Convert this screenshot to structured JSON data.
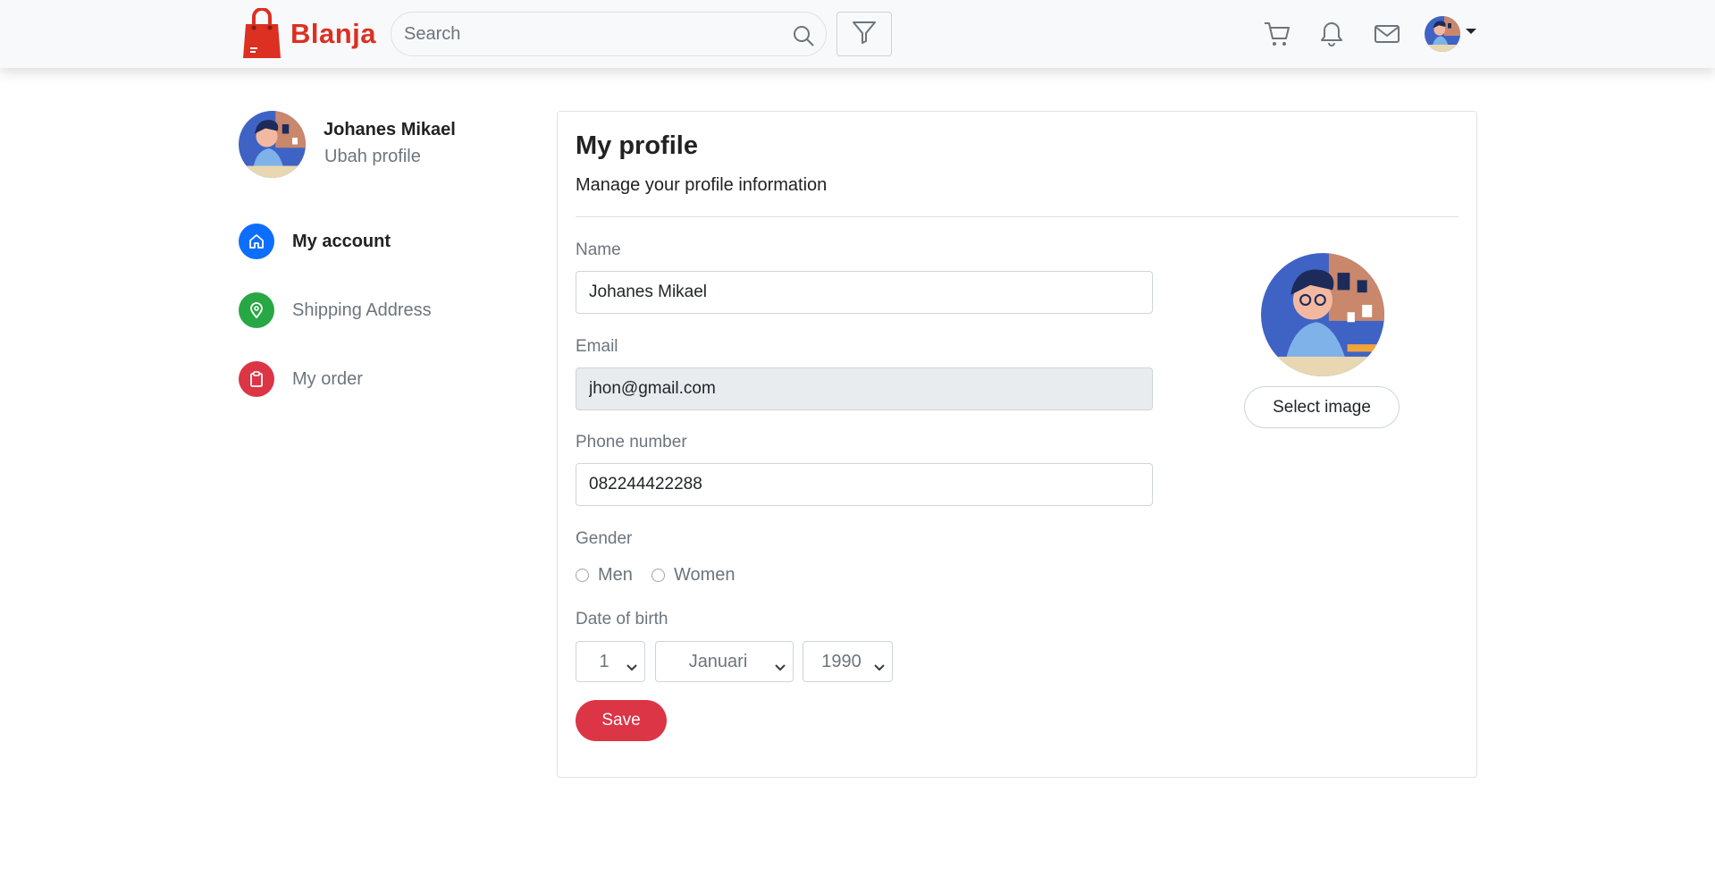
{
  "brand": {
    "name": "Blanja",
    "color": "#db3022"
  },
  "search": {
    "placeholder": "Search"
  },
  "nav": {
    "icons": [
      "filter-icon",
      "cart-icon",
      "bell-icon",
      "mail-icon"
    ]
  },
  "sidebar": {
    "user_name": "Johanes Mikael",
    "edit_label": "Ubah profile",
    "items": [
      {
        "label": "My account",
        "icon": "home-icon",
        "color": "#0d6efd",
        "active": true
      },
      {
        "label": "Shipping Address",
        "icon": "map-pin-icon",
        "color": "#28a745",
        "active": false
      },
      {
        "label": "My order",
        "icon": "clipboard-icon",
        "color": "#dc3545",
        "active": false
      }
    ]
  },
  "profile": {
    "title": "My profile",
    "subtitle": "Manage your profile information",
    "name_label": "Name",
    "name_value": "Johanes Mikael",
    "email_label": "Email",
    "email_value": "jhon@gmail.com",
    "phone_label": "Phone number",
    "phone_value": "082244422288",
    "gender_label": "Gender",
    "gender_options": [
      "Men",
      "Women"
    ],
    "dob_label": "Date of birth",
    "dob_day": "1",
    "dob_month": "Januari",
    "dob_year": "1990",
    "save_label": "Save",
    "select_image_label": "Select image"
  }
}
